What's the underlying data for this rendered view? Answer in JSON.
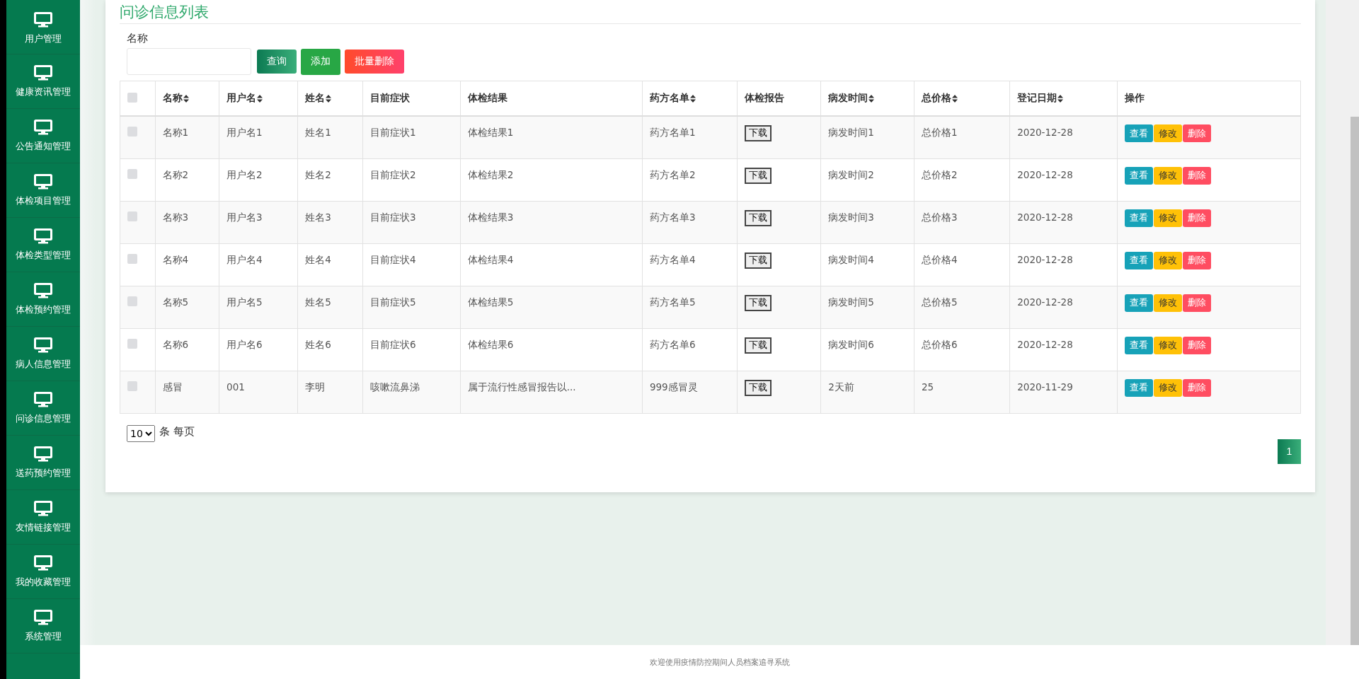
{
  "sidebar": {
    "items": [
      {
        "label": "用户管理"
      },
      {
        "label": "健康资讯管理"
      },
      {
        "label": "公告通知管理"
      },
      {
        "label": "体检项目管理"
      },
      {
        "label": "体检类型管理"
      },
      {
        "label": "体检预约管理"
      },
      {
        "label": "病人信息管理"
      },
      {
        "label": "问诊信息管理"
      },
      {
        "label": "送药预约管理"
      },
      {
        "label": "友情链接管理"
      },
      {
        "label": "我的收藏管理"
      },
      {
        "label": "系统管理"
      }
    ]
  },
  "page": {
    "title": "问诊信息列表"
  },
  "search": {
    "label": "名称"
  },
  "toolbar": [
    {
      "label": "查询",
      "kind": "search"
    },
    {
      "label": "添加",
      "kind": "add"
    },
    {
      "label": "批量删除",
      "kind": "delete"
    }
  ],
  "table": {
    "select_all": {
      "checked": false
    },
    "columns": [
      {
        "kind": "text",
        "label": "名称",
        "sortable": true
      },
      {
        "kind": "text",
        "label": "用户名",
        "sortable": true
      },
      {
        "kind": "text",
        "label": "姓名",
        "sortable": true
      },
      {
        "kind": "text",
        "label": "目前症状",
        "sortable": false
      },
      {
        "kind": "text",
        "label": "体检结果",
        "sortable": false
      },
      {
        "kind": "text",
        "label": "药方名单",
        "sortable": true
      },
      {
        "kind": "download",
        "label": "体检报告",
        "sortable": false
      },
      {
        "kind": "text",
        "label": "病发时间",
        "sortable": true
      },
      {
        "kind": "text",
        "label": "总价格",
        "sortable": true
      },
      {
        "kind": "text",
        "label": "登记日期",
        "sortable": true
      },
      {
        "kind": "actions",
        "label": "操作",
        "sortable": false
      }
    ],
    "rows": [
      {
        "checked": false,
        "cells": [
          "名称1",
          "用户名1",
          "姓名1",
          "目前症状1",
          "体检结果1",
          "药方名单1",
          "下载",
          "病发时间1",
          "总价格1",
          "2020-12-28"
        ],
        "actions": [
          {
            "label": "查看",
            "kind": "view"
          },
          {
            "label": "修改",
            "kind": "edit"
          },
          {
            "label": "删除",
            "kind": "delete"
          }
        ]
      },
      {
        "checked": false,
        "cells": [
          "名称2",
          "用户名2",
          "姓名2",
          "目前症状2",
          "体检结果2",
          "药方名单2",
          "下载",
          "病发时间2",
          "总价格2",
          "2020-12-28"
        ],
        "actions": [
          {
            "label": "查看",
            "kind": "view"
          },
          {
            "label": "修改",
            "kind": "edit"
          },
          {
            "label": "删除",
            "kind": "delete"
          }
        ]
      },
      {
        "checked": false,
        "cells": [
          "名称3",
          "用户名3",
          "姓名3",
          "目前症状3",
          "体检结果3",
          "药方名单3",
          "下载",
          "病发时间3",
          "总价格3",
          "2020-12-28"
        ],
        "actions": [
          {
            "label": "查看",
            "kind": "view"
          },
          {
            "label": "修改",
            "kind": "edit"
          },
          {
            "label": "删除",
            "kind": "delete"
          }
        ]
      },
      {
        "checked": false,
        "cells": [
          "名称4",
          "用户名4",
          "姓名4",
          "目前症状4",
          "体检结果4",
          "药方名单4",
          "下载",
          "病发时间4",
          "总价格4",
          "2020-12-28"
        ],
        "actions": [
          {
            "label": "查看",
            "kind": "view"
          },
          {
            "label": "修改",
            "kind": "edit"
          },
          {
            "label": "删除",
            "kind": "delete"
          }
        ]
      },
      {
        "checked": false,
        "cells": [
          "名称5",
          "用户名5",
          "姓名5",
          "目前症状5",
          "体检结果5",
          "药方名单5",
          "下载",
          "病发时间5",
          "总价格5",
          "2020-12-28"
        ],
        "actions": [
          {
            "label": "查看",
            "kind": "view"
          },
          {
            "label": "修改",
            "kind": "edit"
          },
          {
            "label": "删除",
            "kind": "delete"
          }
        ]
      },
      {
        "checked": false,
        "cells": [
          "名称6",
          "用户名6",
          "姓名6",
          "目前症状6",
          "体检结果6",
          "药方名单6",
          "下载",
          "病发时间6",
          "总价格6",
          "2020-12-28"
        ],
        "actions": [
          {
            "label": "查看",
            "kind": "view"
          },
          {
            "label": "修改",
            "kind": "edit"
          },
          {
            "label": "删除",
            "kind": "delete"
          }
        ]
      },
      {
        "checked": false,
        "cells": [
          "感冒",
          "001",
          "李明",
          "咳嗽流鼻涕",
          "属于流行性感冒报告以...",
          "999感冒灵",
          "下载",
          "2天前",
          "25",
          "2020-11-29"
        ],
        "actions": [
          {
            "label": "查看",
            "kind": "view"
          },
          {
            "label": "修改",
            "kind": "edit"
          },
          {
            "label": "删除",
            "kind": "delete"
          }
        ]
      }
    ]
  },
  "pagination": {
    "page_size": "10",
    "page_size_suffix": "条 每页",
    "pages": [
      {
        "label": "1",
        "selected": true
      }
    ]
  },
  "footer": {
    "text": "欢迎使用疫情防控期间人员档案追寻系统"
  }
}
